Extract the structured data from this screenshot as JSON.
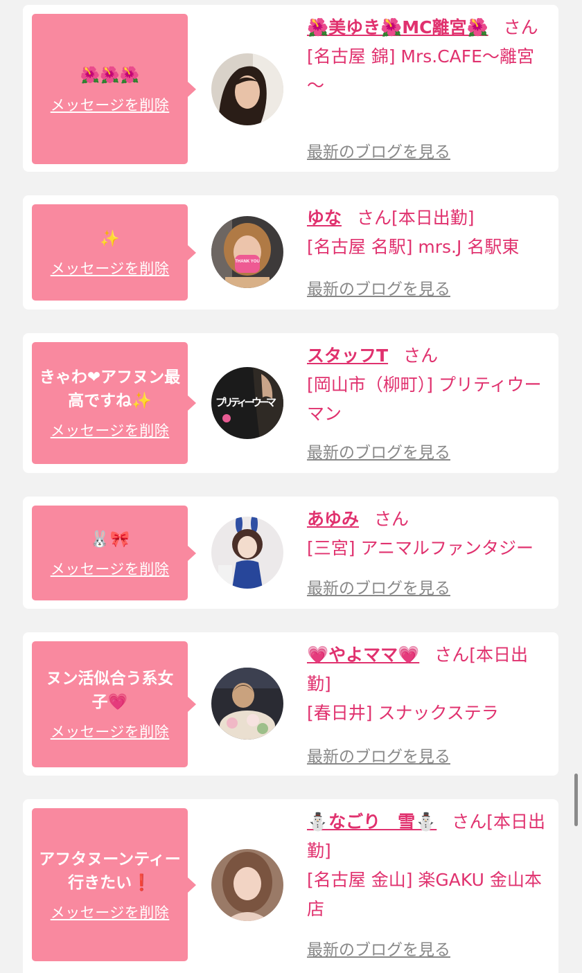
{
  "cards": [
    {
      "message": "🌺🌺🌺",
      "delete_label": "メッセージを削除",
      "name": "🌺美ゆき🌺MC離宮🌺",
      "san": "さん",
      "status": "",
      "shop": "[名古屋 錦] Mrs.CAFE～離宮～",
      "blog_label": "最新のブログを見る"
    },
    {
      "message": "✨",
      "delete_label": "メッセージを削除",
      "name": "ゆな",
      "san": "さん",
      "status": "[本日出勤]",
      "shop": "[名古屋 名駅] mrs.J 名駅東",
      "blog_label": "最新のブログを見る",
      "avatar_text": "THANK YOU"
    },
    {
      "message": "きゃわ❤アフヌン最高ですね✨",
      "delete_label": "メッセージを削除",
      "name": "スタッフT",
      "san": "さん",
      "status": "",
      "shop": "[岡山市（柳町）] プリティウーマン",
      "blog_label": "最新のブログを見る",
      "avatar_text": "プリティーウーマ"
    },
    {
      "message": "🐰🎀",
      "delete_label": "メッセージを削除",
      "name": "あゆみ",
      "san": "さん",
      "status": "",
      "shop": "[三宮] アニマルファンタジー",
      "blog_label": "最新のブログを見る"
    },
    {
      "message": "ヌン活似合う系女子💗",
      "delete_label": "メッセージを削除",
      "name": "💗やよママ💗",
      "san": "さん",
      "status": "[本日出勤]",
      "shop": "[春日井] スナックステラ",
      "blog_label": "最新のブログを見る"
    },
    {
      "message": "アフタヌーンティー行きたい❗️",
      "delete_label": "メッセージを削除",
      "name": "⛄なごり　雪⛄",
      "san": "さん",
      "status": "[本日出勤]",
      "shop": "[名古屋 金山] 楽GAKU 金山本店",
      "blog_label": "最新のブログを見る"
    }
  ],
  "colors": {
    "accent": "#e0316e",
    "bubble": "#f9899f",
    "background": "#f2f2f2",
    "link_gray": "#888888"
  }
}
